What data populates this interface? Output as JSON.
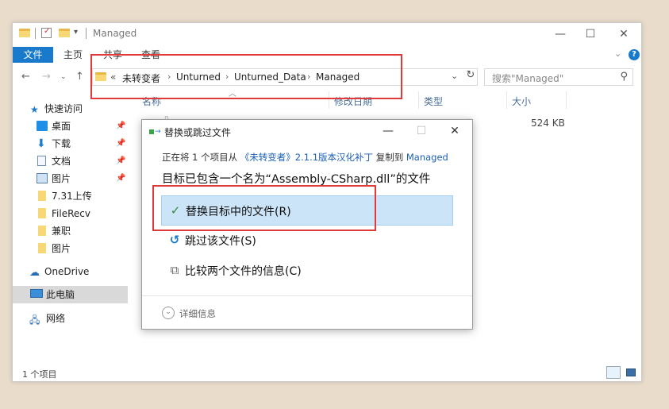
{
  "window": {
    "title": "Managed",
    "controls": {
      "minimize": "—",
      "maximize": "☐",
      "close": "✕"
    }
  },
  "ribbon": {
    "tabs": [
      "文件",
      "主页",
      "共享",
      "查看"
    ],
    "expand": "⌄",
    "help": "?"
  },
  "address": {
    "crumbs": [
      "«",
      "未转变者",
      "Unturned",
      "Unturned_Data",
      "Managed"
    ],
    "search_placeholder": "搜索\"Managed\""
  },
  "columns": [
    "名称",
    "修改日期",
    "类型",
    "大小"
  ],
  "files": [
    {
      "size": "524 KB"
    }
  ],
  "sidebar": {
    "quick_access": "快速访问",
    "items": [
      {
        "label": "桌面",
        "icon": "desktop-icon",
        "pinned": true
      },
      {
        "label": "下载",
        "icon": "download-icon",
        "pinned": true
      },
      {
        "label": "文档",
        "icon": "document-icon",
        "pinned": true
      },
      {
        "label": "图片",
        "icon": "pictures-icon",
        "pinned": true
      },
      {
        "label": "7.31上传",
        "icon": "folder-icon",
        "pinned": false
      },
      {
        "label": "FileRecv",
        "icon": "folder-icon",
        "pinned": false
      },
      {
        "label": "兼职",
        "icon": "folder-icon",
        "pinned": false
      },
      {
        "label": "图片",
        "icon": "folder-icon",
        "pinned": false
      }
    ],
    "onedrive": "OneDrive",
    "this_pc": "此电脑",
    "network": "网络"
  },
  "status": {
    "count": "1 个项目"
  },
  "dialog": {
    "title": "替换或跳过文件",
    "line1_prefix": "正在将 1 个项目从",
    "line1_source": "《未转变者》2.1.1版本汉化补丁",
    "line1_mid": "复制到",
    "line1_dest": "Managed",
    "line2": "目标已包含一个名为“Assembly-CSharp.dll”的文件",
    "options": [
      {
        "label": "替换目标中的文件(R)",
        "icon": "✓"
      },
      {
        "label": "跳过该文件(S)",
        "icon": "↺"
      },
      {
        "label": "比较两个文件的信息(C)",
        "icon": "⧉"
      }
    ],
    "details": "详细信息"
  },
  "colors": {
    "accent": "#1979ca",
    "highlight": "#cce4f7",
    "annotation": "#e03a3a"
  }
}
